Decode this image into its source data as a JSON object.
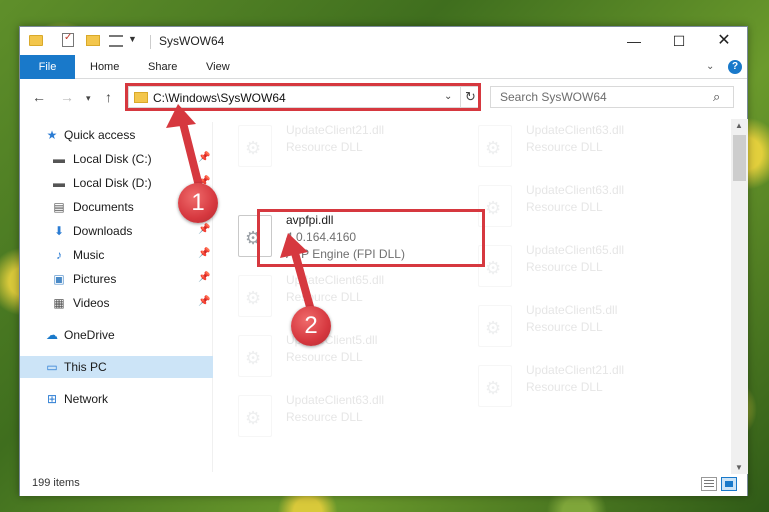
{
  "window": {
    "title": "SysWOW64",
    "controls": {
      "minimize": "—",
      "maximize": "☐",
      "close": "✕"
    }
  },
  "ribbon": {
    "tabs": [
      "File",
      "Home",
      "Share",
      "View"
    ],
    "help": "?"
  },
  "nav": {
    "address": "C:\\Windows\\SysWOW64",
    "search_placeholder": "Search SysWOW64"
  },
  "sidebar": {
    "items": [
      {
        "label": "Quick access",
        "icon": "star-icon",
        "pinned": false
      },
      {
        "label": "Local Disk (C:)",
        "icon": "drive-icon",
        "pinned": true
      },
      {
        "label": "Local Disk (D:)",
        "icon": "drive-icon",
        "pinned": true
      },
      {
        "label": "Documents",
        "icon": "documents-icon",
        "pinned": true
      },
      {
        "label": "Downloads",
        "icon": "download-icon",
        "pinned": true
      },
      {
        "label": "Music",
        "icon": "music-icon",
        "pinned": true
      },
      {
        "label": "Pictures",
        "icon": "pictures-icon",
        "pinned": true
      },
      {
        "label": "Videos",
        "icon": "videos-icon",
        "pinned": true
      },
      {
        "label": "OneDrive",
        "icon": "cloud-icon",
        "pinned": false
      },
      {
        "label": "This PC",
        "icon": "computer-icon",
        "pinned": false,
        "selected": true
      },
      {
        "label": "Network",
        "icon": "network-icon",
        "pinned": false
      }
    ]
  },
  "files": {
    "left_column": [
      {
        "name": "UpdateClient21.dll",
        "type": "Resource DLL"
      },
      {
        "name": "avpfpi.dll",
        "type": "4.0.164.4160",
        "extra": "AVP Engine (FPI DLL)"
      },
      {
        "name": "UpdateClient65.dll",
        "type": "Resource DLL"
      },
      {
        "name": "UpdateClient5.dll",
        "type": "Resource DLL"
      },
      {
        "name": "UpdateClient63.dll",
        "type": "Resource DLL"
      }
    ],
    "right_column": [
      {
        "name": "UpdateClient63.dll",
        "type": "Resource DLL"
      },
      {
        "name": "UpdateClient63.dll",
        "type": "Resource DLL"
      },
      {
        "name": "UpdateClient65.dll",
        "type": "Resource DLL"
      },
      {
        "name": "UpdateClient5.dll",
        "type": "Resource DLL"
      },
      {
        "name": "UpdateClient21.dll",
        "type": "Resource DLL"
      }
    ]
  },
  "status": {
    "item_count": "199 items"
  },
  "annotations": {
    "step1": "1",
    "step2": "2",
    "color": "#d6383f"
  }
}
